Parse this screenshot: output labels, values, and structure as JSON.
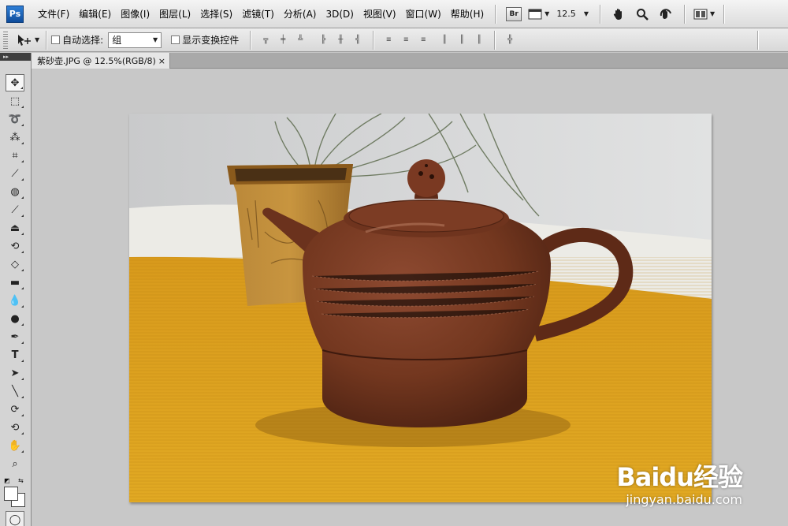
{
  "app": {
    "logo": "Ps"
  },
  "menu": [
    {
      "label": "文件(F)"
    },
    {
      "label": "编辑(E)"
    },
    {
      "label": "图像(I)"
    },
    {
      "label": "图层(L)"
    },
    {
      "label": "选择(S)"
    },
    {
      "label": "滤镜(T)"
    },
    {
      "label": "分析(A)"
    },
    {
      "label": "3D(D)"
    },
    {
      "label": "视图(V)"
    },
    {
      "label": "窗口(W)"
    },
    {
      "label": "帮助(H)"
    }
  ],
  "appbar": {
    "bridge_label": "Br",
    "zoom_value": "12.5"
  },
  "options": {
    "auto_select_label": "自动选择:",
    "auto_select_value": "组",
    "show_transform_label": "显示变换控件"
  },
  "document": {
    "tab_title": "紫砂壶.JPG @ 12.5%(RGB/8)",
    "close_glyph": "×"
  },
  "tools_header": "▸▸",
  "watermark": {
    "brand": "Baidu经验",
    "url": "jingyan.baidu.com"
  },
  "colors": {
    "fg": "#ffffff",
    "bg": "#ffffff",
    "cloth": "#d9a01c",
    "teapot": "#7a3b26"
  }
}
